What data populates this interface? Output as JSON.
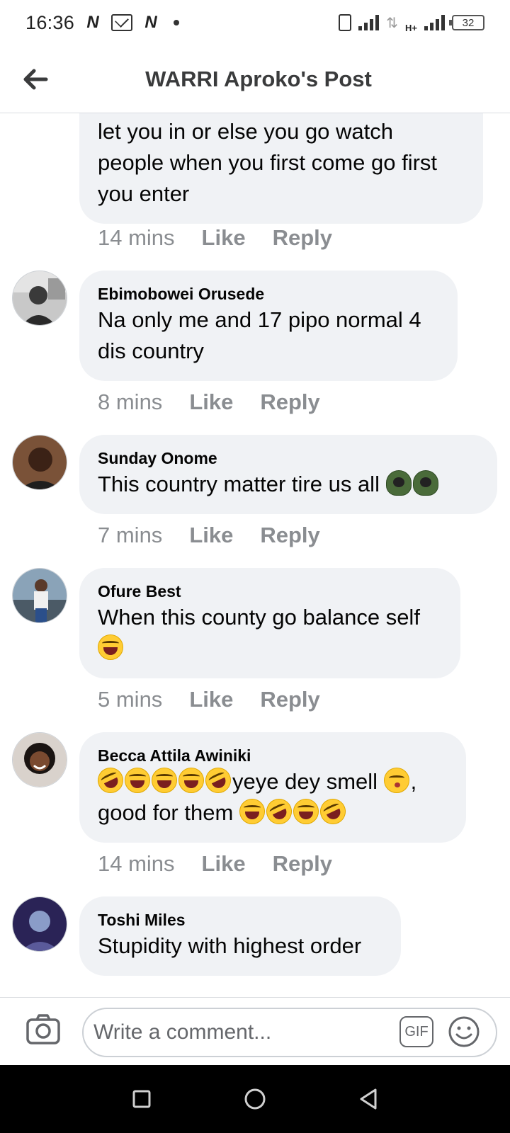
{
  "status_bar": {
    "time": "16:36",
    "notification_icons": [
      "N",
      "mail",
      "N"
    ],
    "battery": "32",
    "network": "H+"
  },
  "header": {
    "title": "WARRI Aproko's Post"
  },
  "comments": [
    {
      "author": "",
      "text": "let you in or else you go watch people when you first come go first you enter",
      "time": "14 mins",
      "like": "Like",
      "reply": "Reply"
    },
    {
      "author": "Ebimobowei Orusede",
      "text": "Na only me and 17 pipo normal 4 dis country",
      "time": "8 mins",
      "like": "Like",
      "reply": "Reply"
    },
    {
      "author": "Sunday Onome",
      "text": "This country matter tire us all",
      "emojis_after": [
        "hooded-figure",
        "hooded-figure"
      ],
      "time": "7 mins",
      "like": "Like",
      "reply": "Reply"
    },
    {
      "author": "Ofure Best",
      "text": "When this county go balance self",
      "emojis_after": [
        "tears-of-joy"
      ],
      "time": "5 mins",
      "like": "Like",
      "reply": "Reply"
    },
    {
      "author": "Becca Attila Awiniki",
      "text_part1": "yeye dey smell",
      "text_part2": ",",
      "text_part3": "good for them",
      "emojis_before": [
        "rolling-laughing",
        "tears-of-joy",
        "tears-of-joy",
        "tears-of-joy",
        "rolling-laughing"
      ],
      "emoji_mid": "kissing-face",
      "emojis_after": [
        "tears-of-joy",
        "rolling-laughing",
        "tears-of-joy",
        "rolling-laughing"
      ],
      "time": "14 mins",
      "like": "Like",
      "reply": "Reply"
    },
    {
      "author": "Toshi Miles",
      "text": "Stupidity with highest order"
    }
  ],
  "composer": {
    "placeholder": "Write a comment...",
    "gif_label": "GIF"
  },
  "colors": {
    "bubble": "#f0f2f5",
    "meta_text": "#8a8d91",
    "header_text": "#3a3b3c",
    "emoji_yellow": "#ffcc33"
  }
}
